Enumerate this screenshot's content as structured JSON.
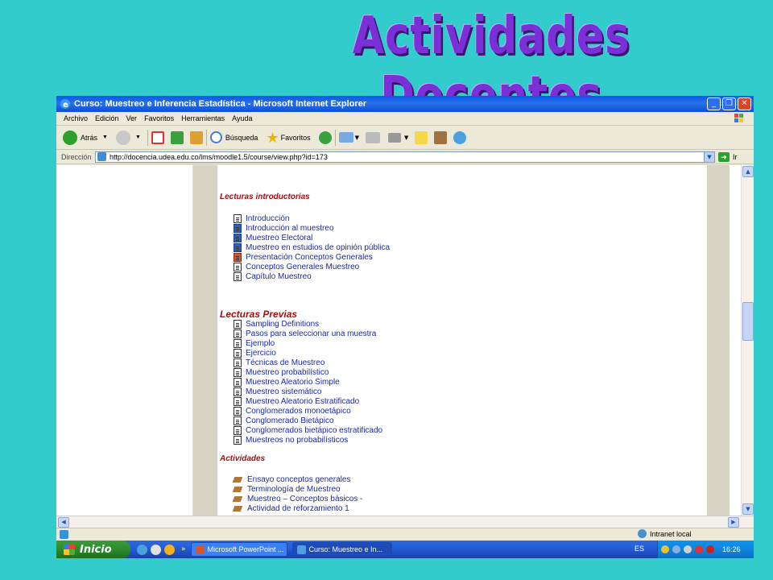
{
  "slide": {
    "title": "Actividades Docentes"
  },
  "window": {
    "title": "Curso: Muestreo e Inferencia Estadística - Microsoft Internet Explorer",
    "buttons": {
      "minimize": "_",
      "restore": "❐",
      "close": "✕"
    }
  },
  "menu": [
    "Archivo",
    "Edición",
    "Ver",
    "Favoritos",
    "Herramientas",
    "Ayuda"
  ],
  "toolbar": {
    "back_label": "Atrás",
    "search_label": "Búsqueda",
    "favorites_label": "Favoritos"
  },
  "address": {
    "label": "Dirección",
    "url": "http://docencia.udea.edu.co/lms/moodle1.5/course/view.php?id=173",
    "go_label": "Ir"
  },
  "sections": [
    {
      "heading": "Lecturas introductorias",
      "items": [
        {
          "label": "Introducción",
          "type": "doc"
        },
        {
          "label": "Introducción al muestreo",
          "type": "word"
        },
        {
          "label": "Muestreo Electoral",
          "type": "word"
        },
        {
          "label": "Muestreo en estudios de opinión pública",
          "type": "word"
        },
        {
          "label": "Presentación Conceptos Generales",
          "type": "ppt"
        },
        {
          "label": "Conceptos Generales Muestreo",
          "type": "doc"
        },
        {
          "label": "Capítulo Muestreo",
          "type": "doc"
        }
      ]
    },
    {
      "heading": "Lecturas Previas",
      "items": [
        {
          "label": "Sampling Definitions",
          "type": "doc"
        },
        {
          "label": "Pasos para seleccionar una muestra",
          "type": "doc"
        },
        {
          "label": "Ejemplo",
          "type": "doc"
        },
        {
          "label": "Ejercicio",
          "type": "doc"
        },
        {
          "label": "Técnicas de Muestreo",
          "type": "doc"
        },
        {
          "label": "Muestreo probabilístico",
          "type": "doc"
        },
        {
          "label": "Muestreo Aleatorio Simple",
          "type": "doc"
        },
        {
          "label": "Muestreo sistemático",
          "type": "doc"
        },
        {
          "label": "Muestreo Aleatorio Estratificado",
          "type": "doc"
        },
        {
          "label": "Conglomerados monoetápico",
          "type": "doc"
        },
        {
          "label": "Conglomerado Bietápico",
          "type": "doc"
        },
        {
          "label": "Conglomerados bietápico estratificado",
          "type": "doc"
        },
        {
          "label": "Muestreos no probabilísticos",
          "type": "doc"
        }
      ]
    },
    {
      "heading": "Actividades",
      "items": [
        {
          "label": "Ensayo conceptos generales",
          "type": "act"
        },
        {
          "label": "Terminología de Muestreo",
          "type": "act"
        },
        {
          "label": "Muestreo – Conceptos básicos -",
          "type": "act"
        },
        {
          "label": "Actividad de reforzamiento 1",
          "type": "act"
        }
      ]
    }
  ],
  "status": {
    "zone": "Intranet local"
  },
  "taskbar": {
    "start_label": "Inicio",
    "tasks": [
      "Microsoft PowerPoint ...",
      "Curso: Muestreo e In..."
    ],
    "language": "ES",
    "clock": "16:26"
  },
  "colors": {
    "link": "#1a2a9c",
    "heading": "#a01010",
    "desktop": "#33cccc",
    "title": "#7b2fd6"
  }
}
